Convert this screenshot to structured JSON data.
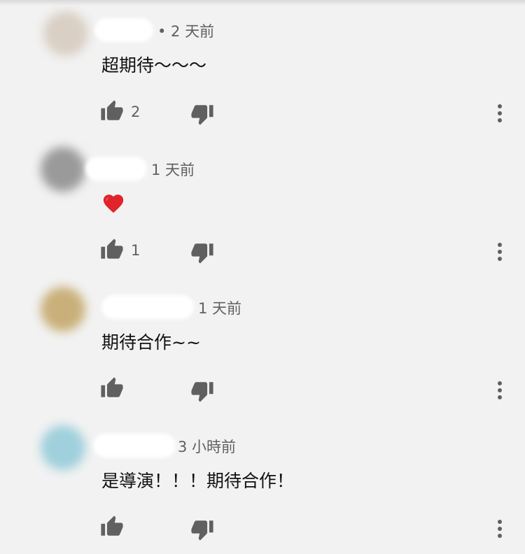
{
  "comments": [
    {
      "author": "",
      "time": "• 2 天前",
      "text": "超期待～～～",
      "likes": "2",
      "avatar_color": "#d9cfc4"
    },
    {
      "author": "",
      "time": "1 天前",
      "text": "❤️",
      "likes": "1",
      "avatar_color": "#9a9a9a"
    },
    {
      "author": "",
      "time": "1 天前",
      "text": "期待合作~~",
      "likes": "",
      "avatar_color": "#c9b07a"
    },
    {
      "author": "",
      "time": "3 小時前",
      "text": "是導演！！！期待合作！",
      "likes": "",
      "avatar_color": "#9fd0dc"
    }
  ],
  "icons": {
    "like": "thumbs-up-icon",
    "dislike": "thumbs-down-icon",
    "more": "more-vert-icon"
  },
  "colors": {
    "background": "#f2f2f2",
    "icon": "#606060",
    "text": "#111111"
  }
}
